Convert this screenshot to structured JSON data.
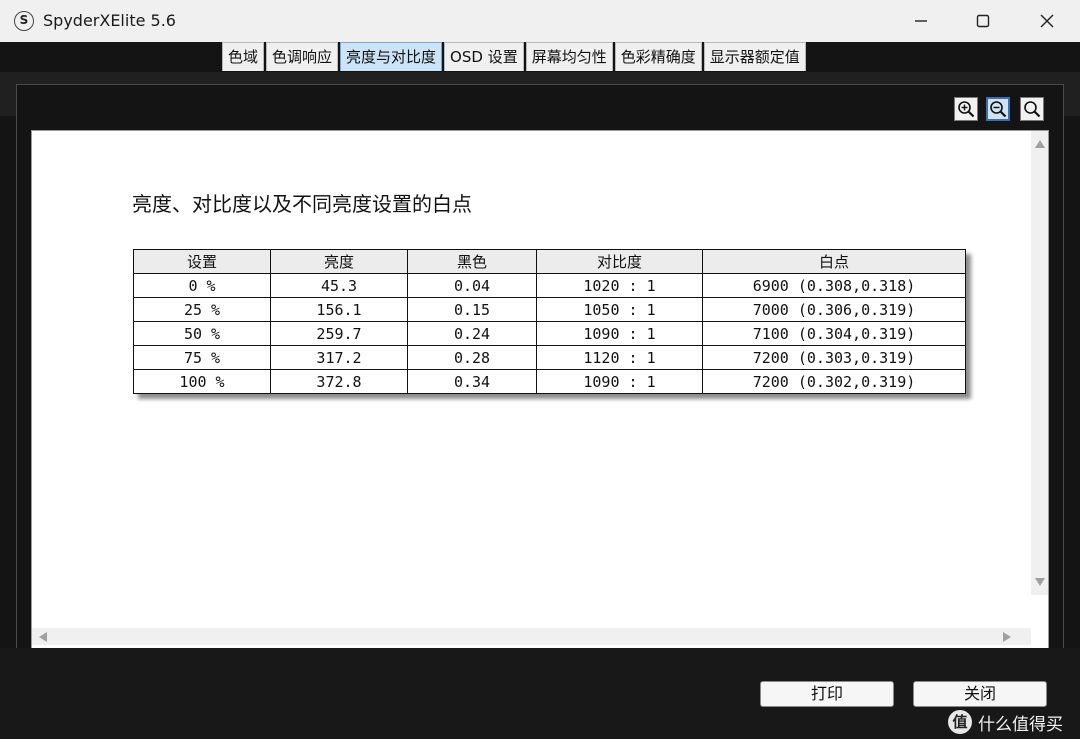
{
  "window": {
    "title": "SpyderXElite 5.6",
    "app_icon_glyph": "S",
    "controls": [
      "minimize-icon",
      "maximize-icon",
      "close-icon"
    ]
  },
  "tabs": [
    {
      "label": "色域",
      "active": false
    },
    {
      "label": "色调响应",
      "active": false
    },
    {
      "label": "亮度与对比度",
      "active": true
    },
    {
      "label": "OSD 设置",
      "active": false
    },
    {
      "label": "屏幕均匀性",
      "active": false
    },
    {
      "label": "色彩精确度",
      "active": false
    },
    {
      "label": "显示器额定值",
      "active": false
    }
  ],
  "zoom_tools": [
    "zoom-in-icon",
    "zoom-out-icon",
    "zoom-fit-icon"
  ],
  "report": {
    "title": "亮度、对比度以及不同亮度设置的白点",
    "columns": [
      "设置",
      "亮度",
      "黑色",
      "对比度",
      "白点"
    ],
    "rows": [
      [
        "0 %",
        "45.3",
        "0.04",
        "1020 : 1",
        "6900 (0.308,0.318)"
      ],
      [
        "25 %",
        "156.1",
        "0.15",
        "1050 : 1",
        "7000 (0.306,0.319)"
      ],
      [
        "50 %",
        "259.7",
        "0.24",
        "1090 : 1",
        "7100 (0.304,0.319)"
      ],
      [
        "75 %",
        "317.2",
        "0.28",
        "1120 : 1",
        "7200 (0.303,0.319)"
      ],
      [
        "100 %",
        "372.8",
        "0.34",
        "1090 : 1",
        "7200 (0.302,0.319)"
      ]
    ]
  },
  "buttons": {
    "print": "打印",
    "close": "关闭"
  },
  "watermark": {
    "icon_glyph": "值",
    "text": "什么值得买"
  },
  "colors": {
    "active_tab": "#cce4f7",
    "canvas": "#ffffff",
    "background": "#141414"
  }
}
